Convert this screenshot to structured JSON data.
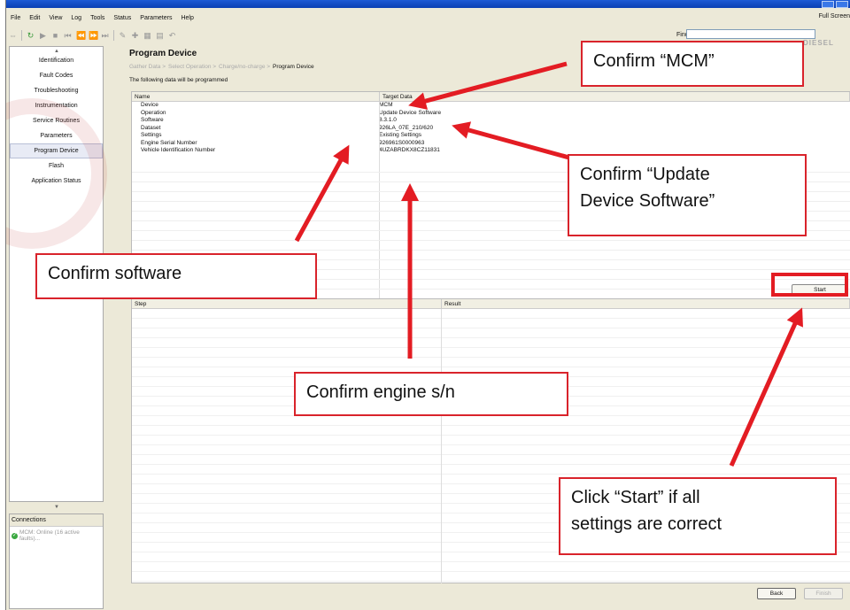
{
  "window": {
    "title": ""
  },
  "menu": [
    "File",
    "Edit",
    "View",
    "Log",
    "Tools",
    "Status",
    "Parameters",
    "Help"
  ],
  "menu_right": "Full Screen",
  "toolbar": {
    "find_label": "Find",
    "find_value": ""
  },
  "brand": "DIESEL",
  "sidebar": {
    "items": [
      {
        "label": "Identification",
        "active": false
      },
      {
        "label": "Fault Codes",
        "active": false
      },
      {
        "label": "Troubleshooting",
        "active": false
      },
      {
        "label": "Instrumentation",
        "active": false
      },
      {
        "label": "Service Routines",
        "active": false
      },
      {
        "label": "Parameters",
        "active": false
      },
      {
        "label": "Program Device",
        "active": true
      },
      {
        "label": "Flash",
        "active": false
      },
      {
        "label": "Application Status",
        "active": false
      }
    ],
    "scroll_up": "▲",
    "scroll_down": "▼"
  },
  "connections": {
    "title": "Connections",
    "status_text": "MCM: Online (16 active faults)..."
  },
  "main": {
    "title": "Program Device",
    "breadcrumb": [
      "Gather Data >",
      "Select Operation >",
      "Charge/no-charge >",
      "Program Device"
    ],
    "intro": "The following data will be programmed",
    "table1": {
      "headers": [
        "Name",
        "Target Data"
      ],
      "rows": [
        {
          "name": "Device",
          "value": "MCM"
        },
        {
          "name": "Operation",
          "value": "Update Device Software"
        },
        {
          "name": "Software",
          "value": "8.3.1.0"
        },
        {
          "name": "Dataset",
          "value": "926LA_07E_210/620"
        },
        {
          "name": "Settings",
          "value": "Existing Settings"
        },
        {
          "name": "Engine Serial Number",
          "value": "926961S0000963"
        },
        {
          "name": "Vehicle Identification Number",
          "value": "4UZABRDKX8CZ11831"
        }
      ]
    },
    "start_label": "Start",
    "table2": {
      "headers": [
        "Step",
        "Result"
      ]
    },
    "back_label": "Back",
    "finish_label": "Finish"
  },
  "annotations": {
    "mcm": "Confirm “MCM”",
    "operation_line1": "Confirm “Update",
    "operation_line2": "Device Software”",
    "software": "Confirm software",
    "engine": "Confirm engine s/n",
    "start_line1": "Click “Start” if all",
    "start_line2": "settings are correct",
    "color": "#e31c23"
  }
}
